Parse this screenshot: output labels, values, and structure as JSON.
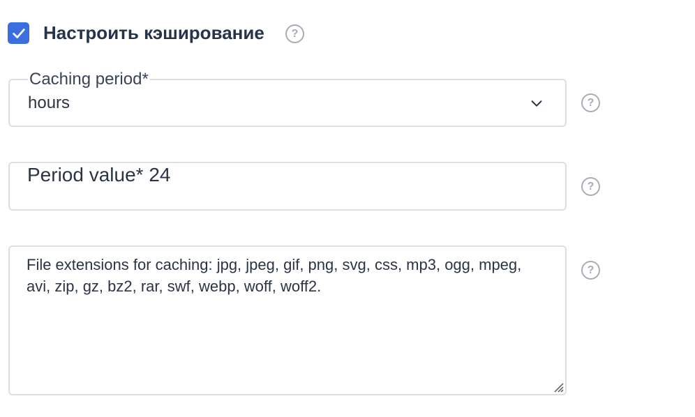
{
  "caching": {
    "checkbox_checked": true,
    "title": "Настроить кэширование"
  },
  "period_select": {
    "label": "Caching period*",
    "value": "hours"
  },
  "period_value": {
    "label": "Period value*",
    "value": "24"
  },
  "extensions": {
    "text": "File extensions for caching: jpg, jpeg, gif, png, svg, css, mp3, ogg, mpeg, avi, zip, gz, bz2, rar, swf, webp, woff, woff2."
  },
  "help": {
    "glyph": "?"
  },
  "colors": {
    "accent": "#3b6fe0",
    "border": "#dcdfe4",
    "help_icon": "#a9adb3",
    "text": "#2b3445"
  }
}
